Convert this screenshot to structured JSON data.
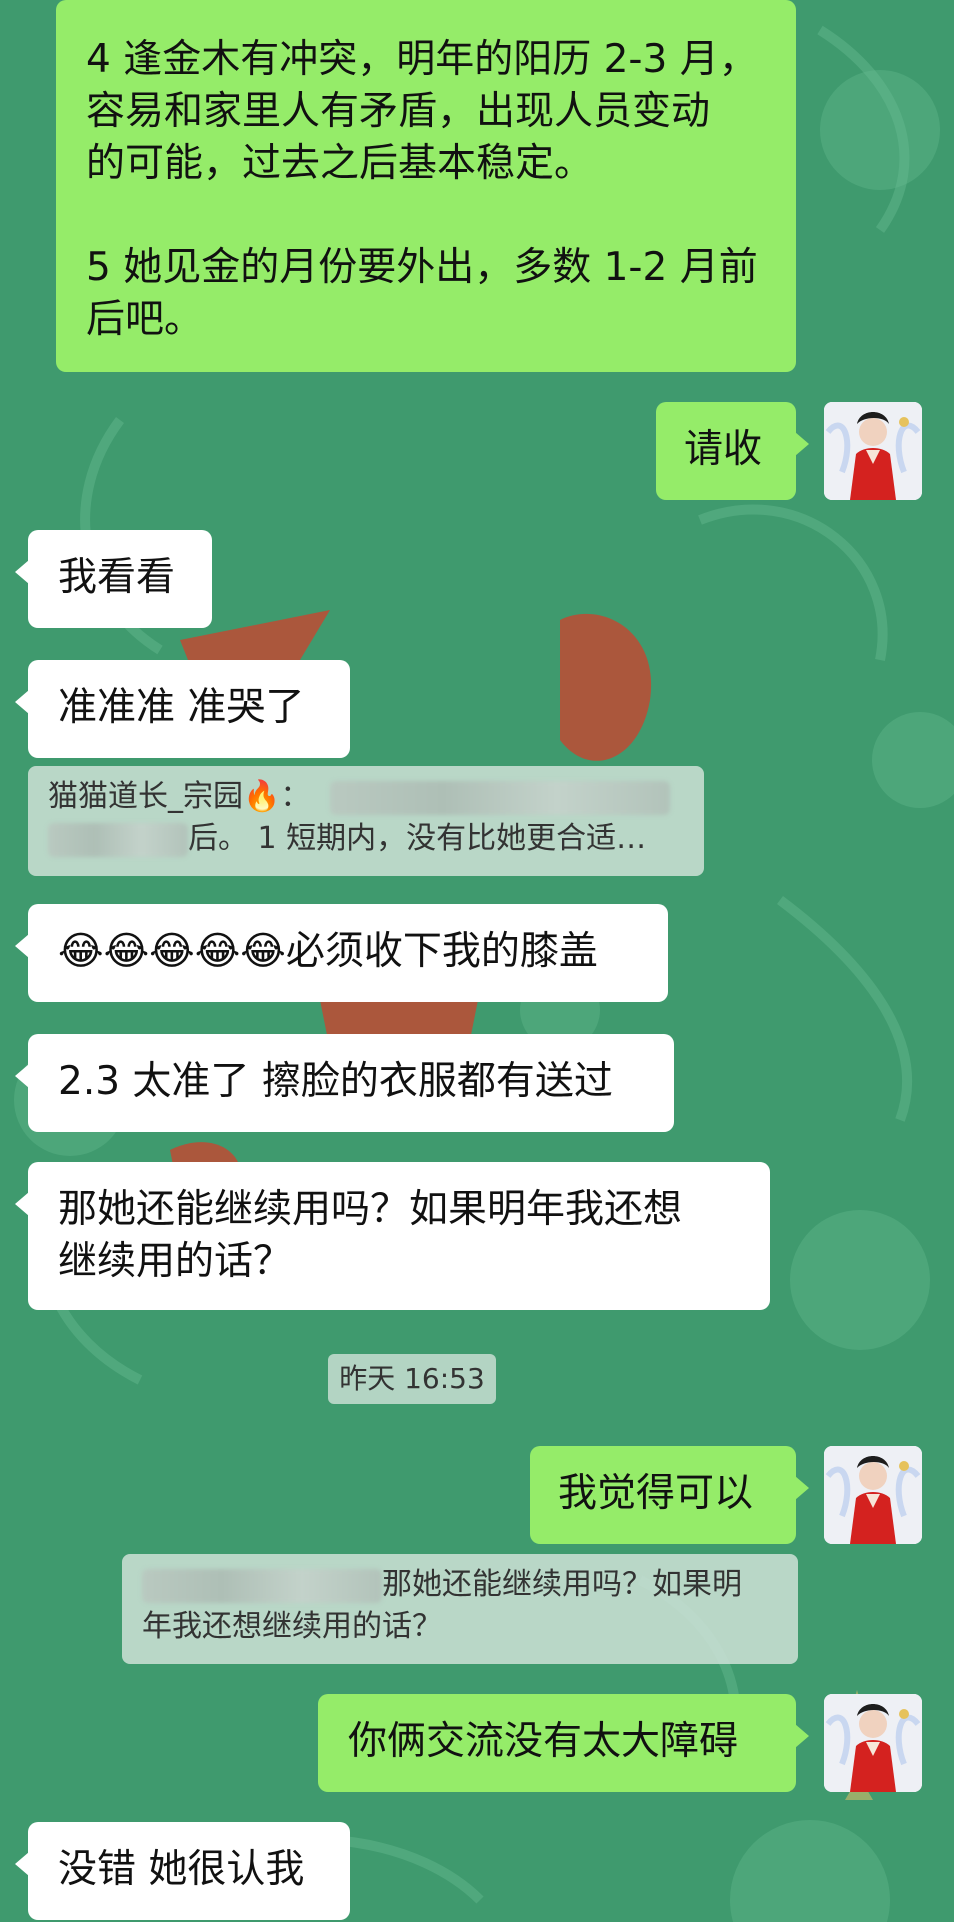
{
  "colors": {
    "background": "#3f9a6e",
    "my_bubble": "#95ec69",
    "their_bubble": "#ffffff",
    "quote_bg": "#cde1d6"
  },
  "messages": [
    {
      "sender": "me",
      "lines": [
        "4 逢金木有冲突，明年的阳历 2-3 月，",
        "容易和家里人有矛盾，出现人员变动",
        "的可能，过去之后基本稳定。",
        "",
        "5 她见金的月份要外出，多数 1-2 月前",
        "后吧。"
      ]
    },
    {
      "sender": "me",
      "text": "请收"
    },
    {
      "sender": "them",
      "text": "我看看"
    },
    {
      "sender": "them",
      "text": "准准准 准哭了"
    },
    {
      "sender": "them",
      "text": "😂😂😂😂😂必须收下我的膝盖"
    },
    {
      "sender": "them",
      "text": "2.3 太准了 擦脸的衣服都有送过"
    },
    {
      "sender": "them",
      "lines": [
        "那她还能继续用吗？如果明年我还想",
        "继续用的话？"
      ]
    },
    {
      "sender": "me",
      "text": "我觉得可以"
    },
    {
      "sender": "me",
      "text": "你俩交流没有太大障碍"
    },
    {
      "sender": "them",
      "text": "没错 她很认我"
    }
  ],
  "quotes": [
    {
      "name": "猫猫道长_宗园🔥：",
      "line2": "后。 1 短期内，没有比她更合适…"
    },
    {
      "line1": "那她还能继续用吗？如果明",
      "line2": "年我还想继续用的话？"
    }
  ],
  "timestamp": "昨天 16:53",
  "avatar_icon": "avatar-woman-red-hanfu"
}
